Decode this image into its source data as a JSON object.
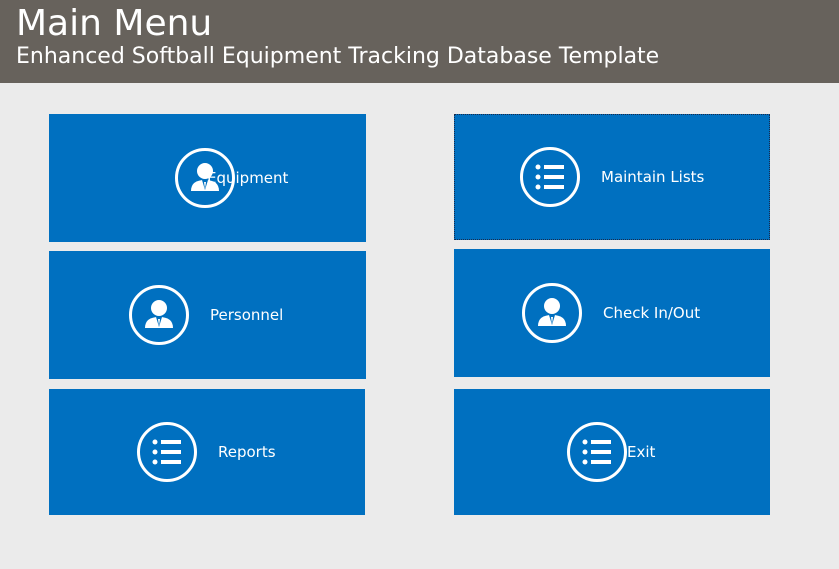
{
  "header": {
    "title": "Main Menu",
    "subtitle": "Enhanced Softball Equipment Tracking Database Template"
  },
  "colors": {
    "header_bg": "#67625c",
    "tile_bg": "#0070c0",
    "page_bg": "#ebebeb",
    "text": "#ffffff"
  },
  "tiles": [
    {
      "label": "Equipment",
      "icon": "person-icon"
    },
    {
      "label": "Maintain Lists",
      "icon": "list-icon"
    },
    {
      "label": "Personnel",
      "icon": "person-icon"
    },
    {
      "label": "Check In/Out",
      "icon": "person-icon"
    },
    {
      "label": "Reports",
      "icon": "list-icon"
    },
    {
      "label": "Exit",
      "icon": "list-icon"
    }
  ]
}
